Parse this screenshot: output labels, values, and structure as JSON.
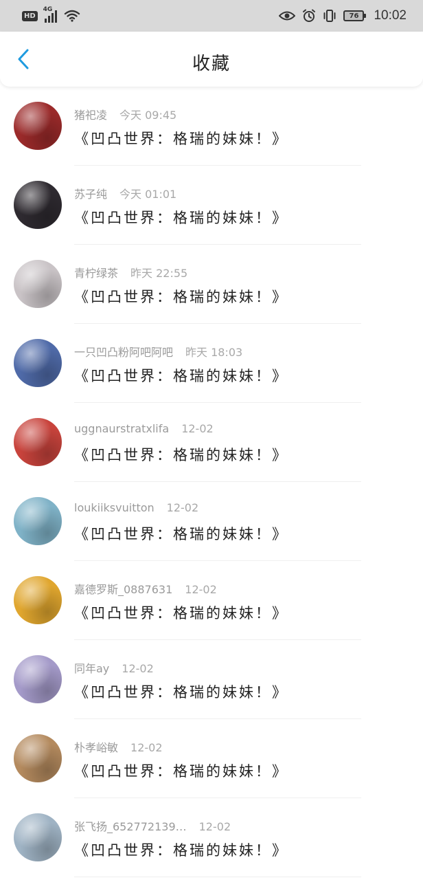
{
  "status_bar": {
    "hd": "HD",
    "network": "4G",
    "battery": "76",
    "time": "10:02"
  },
  "header": {
    "title": "收藏"
  },
  "items": [
    {
      "user": "猪祀凌",
      "time": "今天 09:45",
      "title": "《凹凸世界：格瑞的妹妹！》",
      "avatar_color": "#9b2a2a"
    },
    {
      "user": "苏子纯",
      "time": "今天 01:01",
      "title": "《凹凸世界：格瑞的妹妹！》",
      "avatar_color": "#2e2a30"
    },
    {
      "user": "青柠绿茶",
      "time": "昨天 22:55",
      "title": "《凹凸世界：格瑞的妹妹！》",
      "avatar_color": "#c9c3c6"
    },
    {
      "user": "一只凹凸粉阿吧阿吧",
      "time": "昨天 18:03",
      "title": "《凹凸世界：格瑞的妹妹！》",
      "avatar_color": "#4f6aa8"
    },
    {
      "user": "uggnaurstratxlifa",
      "time": "12-02",
      "title": "《凹凸世界：格瑞的妹妹！》",
      "avatar_color": "#c8433c"
    },
    {
      "user": "loukiiksvuitton",
      "time": "12-02",
      "title": "《凹凸世界：格瑞的妹妹！》",
      "avatar_color": "#7fb2c7"
    },
    {
      "user": "嘉德罗斯_0887631",
      "time": "12-02",
      "title": "《凹凸世界：格瑞的妹妹！》",
      "avatar_color": "#e0a62e"
    },
    {
      "user": "同年ay",
      "time": "12-02",
      "title": "《凹凸世界：格瑞的妹妹！》",
      "avatar_color": "#a49ac9"
    },
    {
      "user": "朴孝峪敏",
      "time": "12-02",
      "title": "《凹凸世界：格瑞的妹妹！》",
      "avatar_color": "#b48a5e"
    },
    {
      "user": "张飞扬_652772139…",
      "time": "12-02",
      "title": "《凹凸世界：格瑞的妹妹！》",
      "avatar_color": "#9fb3c4"
    }
  ]
}
